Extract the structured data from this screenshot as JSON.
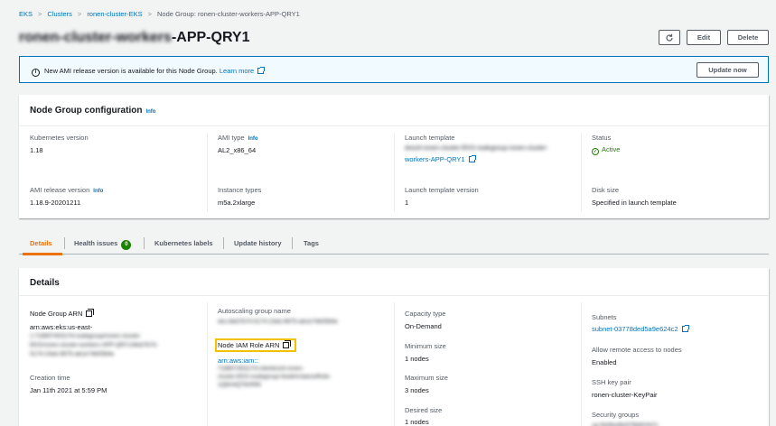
{
  "breadcrumb": {
    "items": [
      "EKS",
      "Clusters",
      "ronen-cluster-EKS",
      "Node Group: ronen-cluster-workers-APP-QRY1"
    ]
  },
  "header": {
    "title_prefix": "ronen-cluster-workers",
    "title_suffix": "-APP-QRY1",
    "edit_label": "Edit",
    "delete_label": "Delete",
    "refresh_icon": "refresh-icon"
  },
  "banner": {
    "text": "New AMI release version is available for this Node Group.",
    "link": "Learn more",
    "button": "Update now"
  },
  "config": {
    "title": "Node Group configuration",
    "info": "Info",
    "kubernetes_version": {
      "label": "Kubernetes version",
      "value": "1.18"
    },
    "ami_type": {
      "label": "AMI type",
      "info": "Info",
      "value": "AL2_x86_64"
    },
    "launch_template": {
      "label": "Launch template",
      "value_blurred": "eksctl-ronen-cluster-EKS-nodegroup-ronen-cluster-",
      "value": "workers-APP-QRY1"
    },
    "status": {
      "label": "Status",
      "value": "Active"
    },
    "ami_release": {
      "label": "AMI release version",
      "info": "Info",
      "value": "1.18.9-20201211"
    },
    "instance_types": {
      "label": "Instance types",
      "value": "m5a.2xlarge"
    },
    "launch_template_version": {
      "label": "Launch template version",
      "value": "1"
    },
    "disk_size": {
      "label": "Disk size",
      "value": "Specified in launch template"
    }
  },
  "tabs": {
    "details": "Details",
    "health": "Health issues",
    "health_count": "0",
    "labels": "Kubernetes labels",
    "history": "Update history",
    "tags": "Tags"
  },
  "details": {
    "title": "Details",
    "node_group_arn": {
      "label": "Node Group ARN",
      "value_visible": "arn:aws:eks:us-east-",
      "value_blurred_1": "1:718807403174:nodegroup/ronen-cluster-",
      "value_blurred_2": "EKS/ronen-cluster-workers-APP-QRY1/8eb7b74-",
      "value_blurred_3": "5174-23eb-9675-ab1e74b0584e"
    },
    "creation_time": {
      "label": "Creation time",
      "value": "Jan 11th 2021 at 5:59 PM"
    },
    "asg_name": {
      "label": "Autoscaling group name",
      "value_blurred": "eks-8eb7b74-5174-23eb-9675-ab1e74b0584e"
    },
    "node_iam_role": {
      "label": "Node IAM Role ARN",
      "value_visible": "arn:aws:iam::",
      "value_blurred_1": "718807403174:role/eksctl-ronen-",
      "value_blurred_2": "cluster-EKS-nodegroup-NodeInstanceRole-",
      "value_blurred_3": "1Q6A4QT6ARW"
    },
    "capacity_type": {
      "label": "Capacity type",
      "value": "On-Demand"
    },
    "min_size": {
      "label": "Minimum size",
      "value": "1 nodes"
    },
    "max_size": {
      "label": "Maximum size",
      "value": "3 nodes"
    },
    "desired_size": {
      "label": "Desired size",
      "value": "1 nodes"
    },
    "subnets": {
      "label": "Subnets",
      "value": "subnet-03778ded5a9e624c2"
    },
    "remote_access": {
      "label": "Allow remote access to nodes",
      "value": "Enabled"
    },
    "ssh_key": {
      "label": "SSH key pair",
      "value": "ronen-cluster-KeyPair"
    },
    "security_groups": {
      "label": "Security groups",
      "value_blurred": "sg-0b46ed6e576b602b7c"
    }
  },
  "colors": {
    "link": "#0073bb",
    "active_tab": "#ec7211",
    "success": "#1d8102",
    "highlight": "#f2c100",
    "banner_bg": "#f1faff"
  }
}
